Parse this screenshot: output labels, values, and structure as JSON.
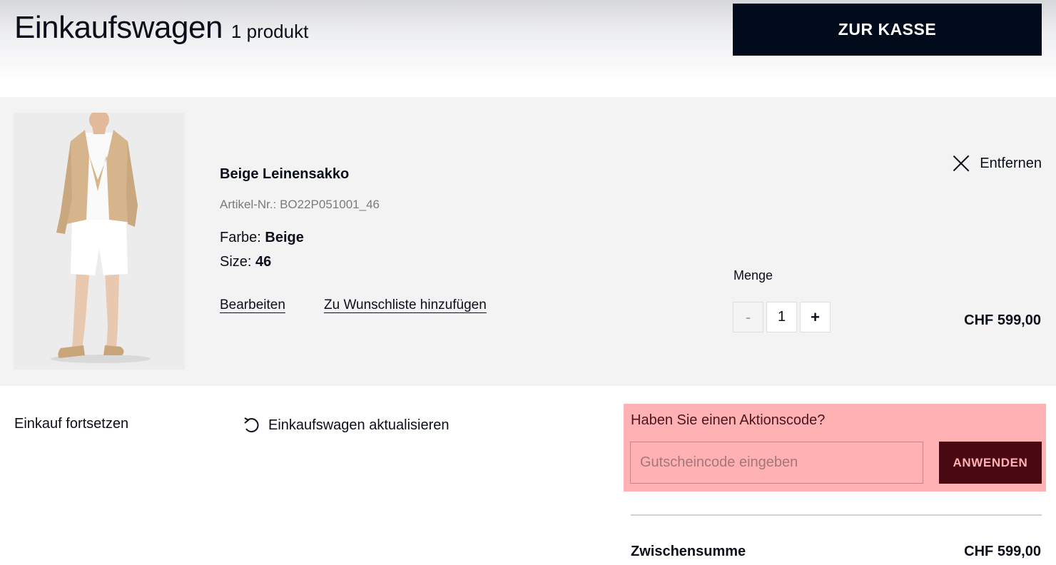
{
  "header": {
    "title": "Einkaufswagen",
    "count": "1 produkt",
    "checkout_label": "ZUR KASSE"
  },
  "cart_item": {
    "image_alt": "Beige Leinensakko",
    "name": "Beige Leinensakko",
    "sku_label": "Artikel-Nr.:",
    "sku_value": "BO22P051001_46",
    "color_label": "Farbe:",
    "color_value": "Beige",
    "size_label": "Size:",
    "size_value": "46",
    "edit_label": "Bearbeiten",
    "wishlist_label": "Zu Wunschliste hinzufügen",
    "remove_label": "Entfernen",
    "qty_label": "Menge",
    "qty_minus": "-",
    "qty_value": "1",
    "qty_plus": "+",
    "price": "CHF 599,00"
  },
  "actions": {
    "continue_label": "Einkauf fortsetzen",
    "update_label": "Einkaufswagen aktualisieren"
  },
  "promo": {
    "title": "Haben Sie einen Aktionscode?",
    "placeholder": "Gutscheincode eingeben",
    "apply_label": "ANWENDEN"
  },
  "summary": {
    "subtotal_label": "Zwischensumme",
    "subtotal_value": "CHF 599,00"
  },
  "colors": {
    "primary_dark": "#020b1c",
    "row_background": "#f3f3f3",
    "promo_background": "#ffb1b3",
    "promo_button": "#4a0812"
  }
}
